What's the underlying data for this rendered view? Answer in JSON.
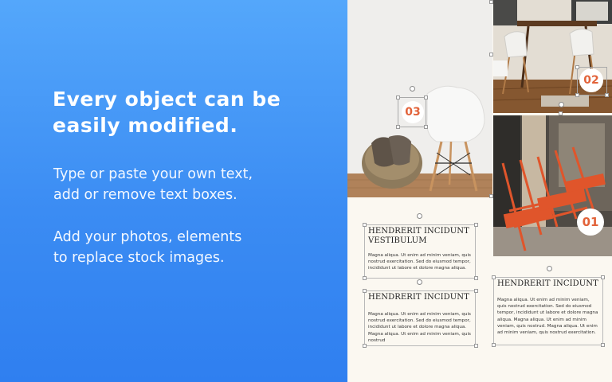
{
  "promo": {
    "headline_line1": "Every object can be",
    "headline_line2": "easily modified.",
    "para1_line1": "Type or paste your own text,",
    "para1_line2": "add or remove text boxes.",
    "para2_line1": "Add your photos, elements",
    "para2_line2": "to replace stock images."
  },
  "canvas": {
    "badges": [
      {
        "label": "03"
      },
      {
        "label": "02"
      },
      {
        "label": "01"
      }
    ],
    "textboxes": [
      {
        "heading_line1": "HENDRERIT INCIDUNT",
        "heading_line2": "VESTIBULUM",
        "body": "Magna aliqua. Ut enim ad minim veniam, quis nostrud exercitation. Sed do eiusmod tempor, incididunt ut labore et dolore magna aliqua."
      },
      {
        "heading_line1": "HENDRERIT INCIDUNT",
        "body": "Magna aliqua. Ut enim ad minim veniam, quis nostrud exercitation. Sed do eiusmod tempor, incididunt ut labore et dolore magna aliqua. Magna aliqua. Ut enim ad minim veniam, quis nostrud"
      },
      {
        "heading_line1": "HENDRERIT INCIDUNT",
        "body": "Magna aliqua. Ut enim ad minim veniam, quis nostrud exercitation. Sed do eiusmod tempor, incididunt ut labore et dolore magna aliqua. Magna aliqua. Ut enim ad minim veniam, quis nostrud. Magna aliqua. Ut enim ad minim veniam, quis nostrud exercitation."
      }
    ]
  },
  "colors": {
    "accent_orange": "#e2633a",
    "promo_blue": "#3b8cf3"
  }
}
